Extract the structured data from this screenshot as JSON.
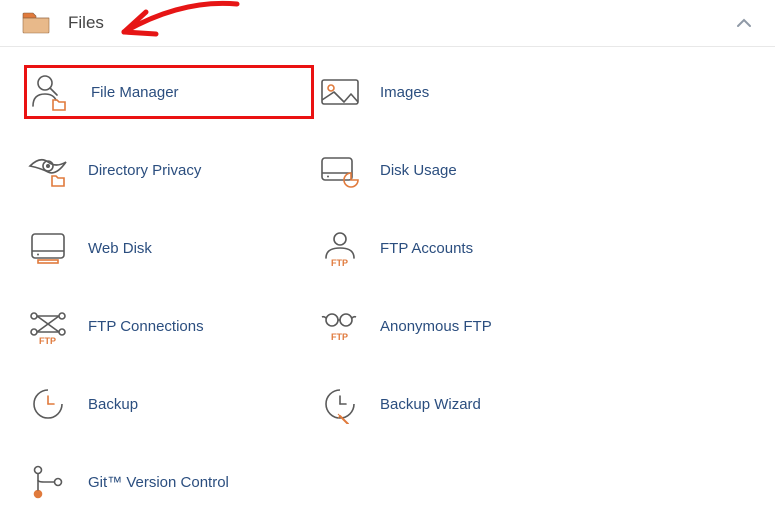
{
  "panel": {
    "title": "Files"
  },
  "items": {
    "file_manager": "File Manager",
    "images": "Images",
    "directory_privacy": "Directory Privacy",
    "disk_usage": "Disk Usage",
    "web_disk": "Web Disk",
    "ftp_accounts": "FTP Accounts",
    "ftp_connections": "FTP Connections",
    "anonymous_ftp": "Anonymous FTP",
    "backup": "Backup",
    "backup_wizard": "Backup Wizard",
    "git_vcs": "Git™ Version Control"
  }
}
